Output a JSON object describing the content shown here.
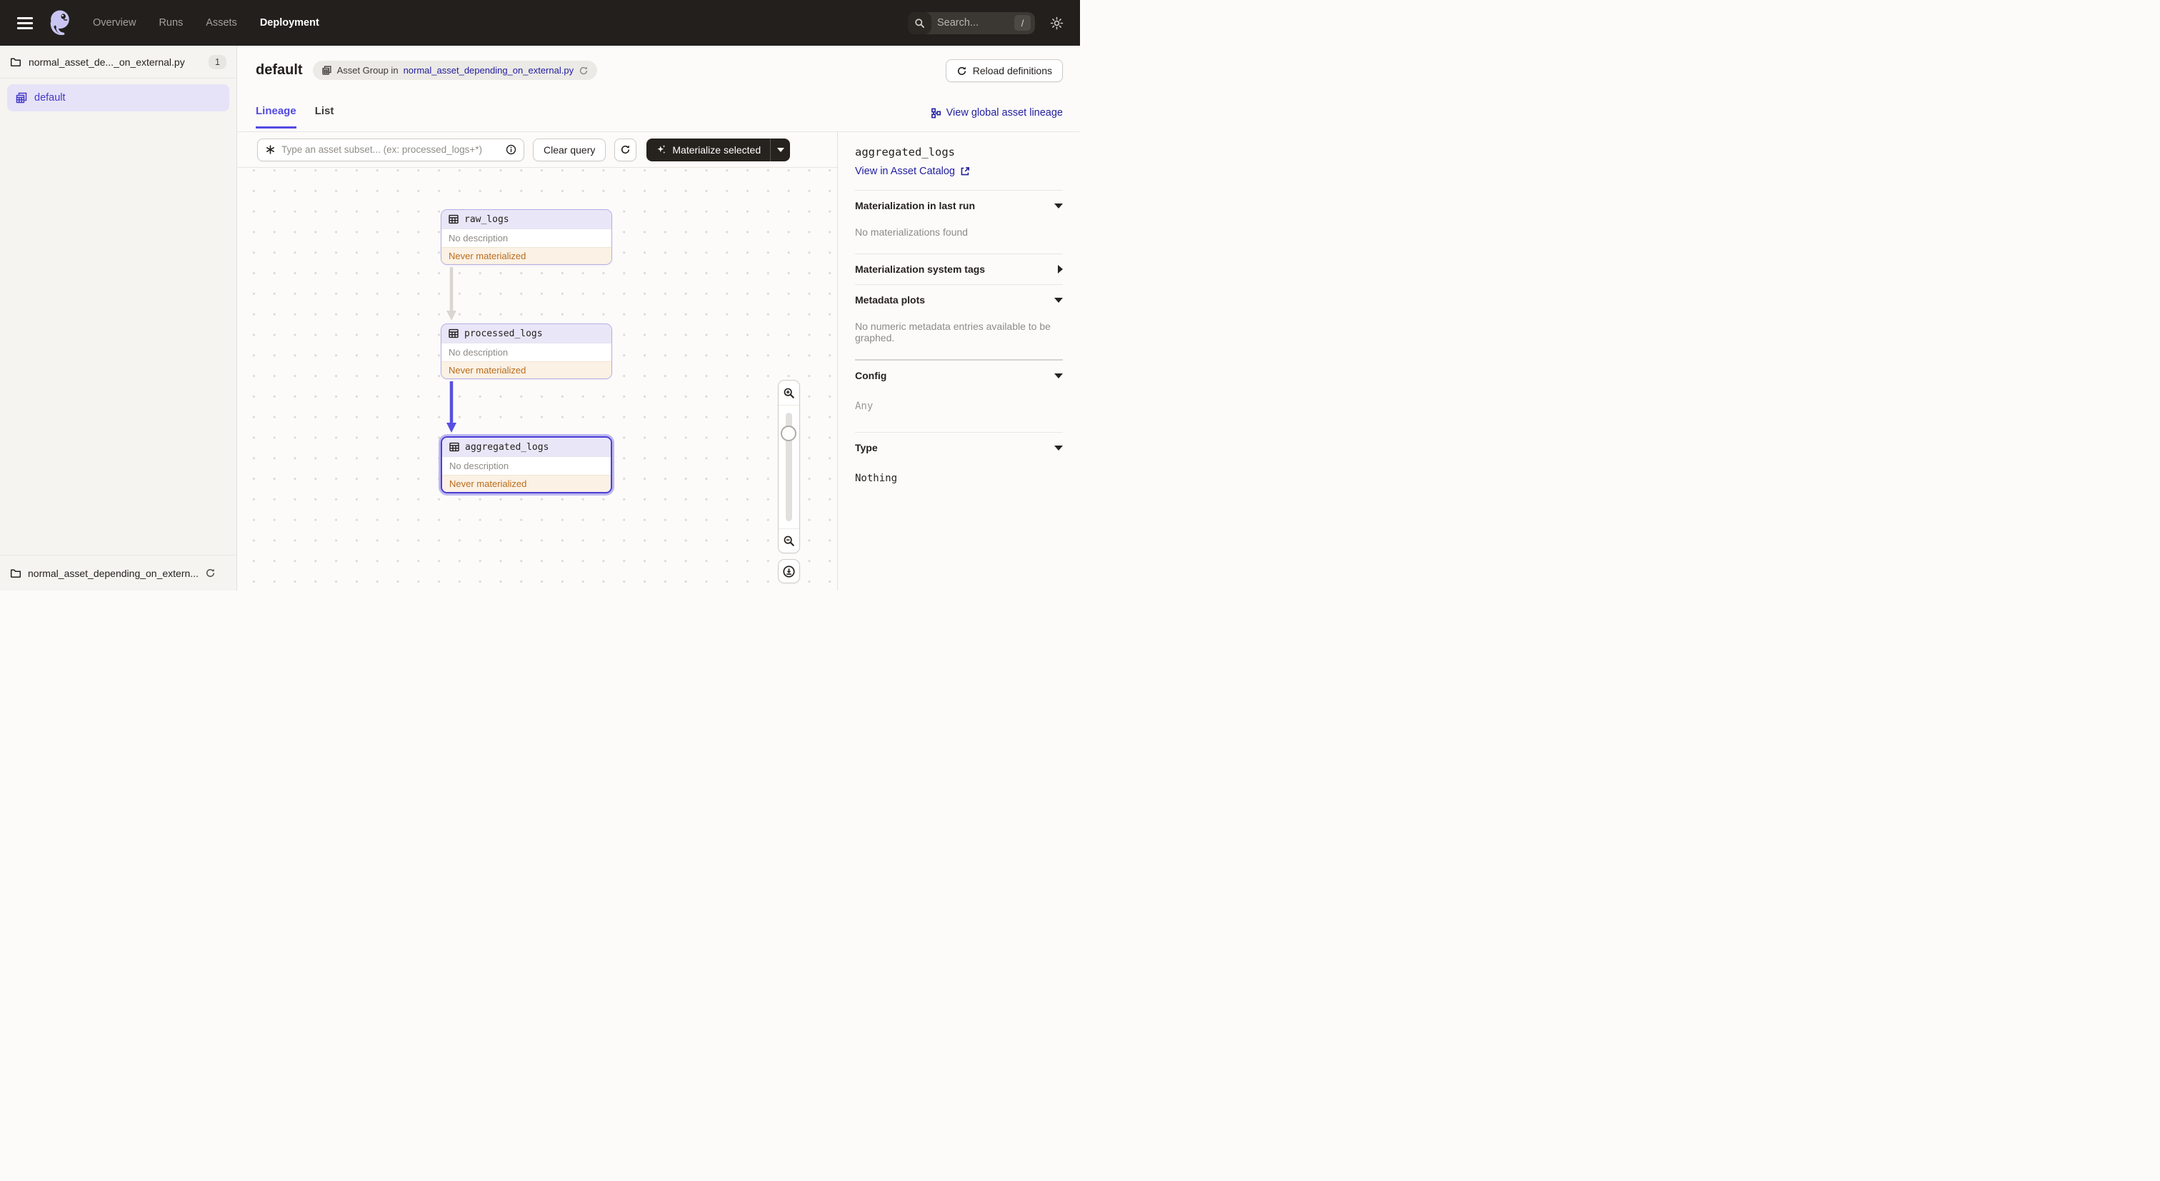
{
  "nav": {
    "items": [
      "Overview",
      "Runs",
      "Assets",
      "Deployment"
    ],
    "active_item": "Deployment",
    "search_placeholder": "Search...",
    "search_shortcut": "/"
  },
  "sidebar": {
    "file_label": "normal_asset_de..._on_external.py",
    "file_count": "1",
    "group_label": "default",
    "footer_label": "normal_asset_depending_on_extern..."
  },
  "header": {
    "title": "default",
    "breadcrumb_prefix": "Asset Group in",
    "breadcrumb_link": "normal_asset_depending_on_external.py",
    "reload_button": "Reload definitions"
  },
  "tabs": {
    "lineage_label": "Lineage",
    "list_label": "List",
    "active": "Lineage",
    "global_lineage_link": "View global asset lineage"
  },
  "toolbar": {
    "query_placeholder": "Type an asset subset... (ex: processed_logs+*)",
    "clear_button": "Clear query",
    "materialize_button": "Materialize selected"
  },
  "graph": {
    "nodes": [
      {
        "name": "raw_logs",
        "description": "No description",
        "status": "Never materialized",
        "selected": false
      },
      {
        "name": "processed_logs",
        "description": "No description",
        "status": "Never materialized",
        "selected": false
      },
      {
        "name": "aggregated_logs",
        "description": "No description",
        "status": "Never materialized",
        "selected": true
      }
    ]
  },
  "panel": {
    "title": "aggregated_logs",
    "catalog_link": "View in Asset Catalog",
    "sections": [
      {
        "label": "Materialization in last run",
        "state": "expanded",
        "body": "No materializations found"
      },
      {
        "label": "Materialization system tags",
        "state": "collapsed",
        "body": ""
      },
      {
        "label": "Metadata plots",
        "state": "expanded",
        "body": "No numeric metadata entries available to be graphed."
      },
      {
        "label": "Config",
        "state": "expanded",
        "body": "Any"
      },
      {
        "label": "Type",
        "state": "expanded",
        "body": "Nothing"
      }
    ]
  },
  "colors": {
    "nav_bg": "#231F1C",
    "accent": "#5349E1",
    "link": "#23209F",
    "selected_node_border": "#4B3FD6",
    "node_border": "#B4AEE6",
    "warning_text": "#B96D1E",
    "warning_bg": "#FBF1E4"
  }
}
